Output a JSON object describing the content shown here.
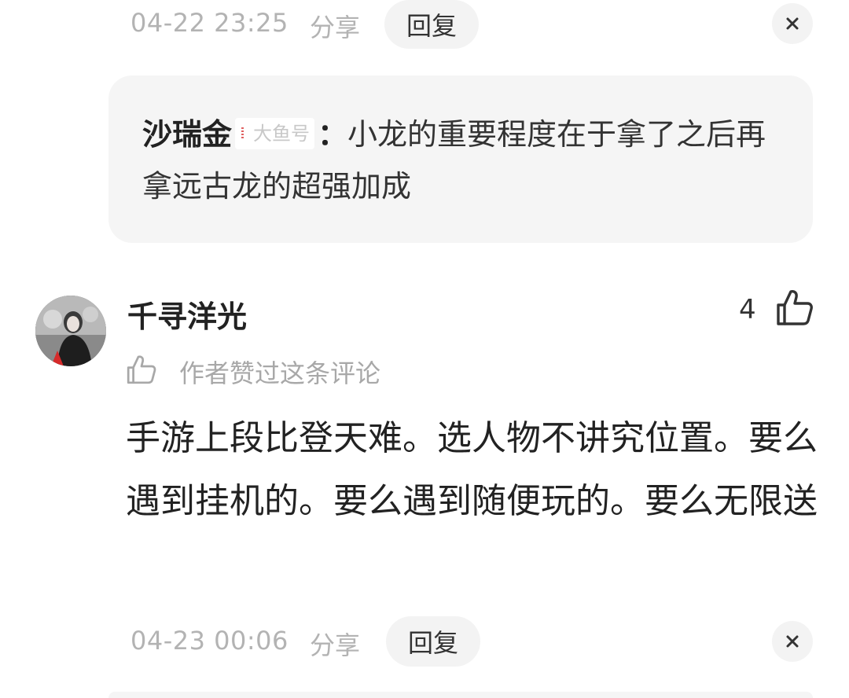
{
  "top_meta": {
    "time": "04-22 23:25",
    "share_label": "分享",
    "reply_label": "回复",
    "close_glyph": "×"
  },
  "quote": {
    "author": "沙瑞金",
    "badge": "大鱼号",
    "separator": "：",
    "text": "小龙的重要程度在于拿了之后再拿远古龙的超强加成"
  },
  "comment": {
    "username": "千寻洋光",
    "like_count": "4",
    "author_liked_text": "作者赞过这条评论",
    "body": "手游上段比登天难。选人物不讲究位置。要么遇到挂机的。要么遇到随便玩的。要么无限送"
  },
  "bottom_meta": {
    "time": "04-23 00:06",
    "share_label": "分享",
    "reply_label": "回复",
    "close_glyph": "×"
  },
  "icons": {
    "like": "thumbs-up-icon",
    "author_like": "thumbs-up-outline-icon",
    "close": "close-icon"
  },
  "colors": {
    "muted_text": "#b3b3b3",
    "bubble_bg": "#f3f3f3",
    "quote_bg": "#f5f5f5",
    "text": "#222222"
  }
}
